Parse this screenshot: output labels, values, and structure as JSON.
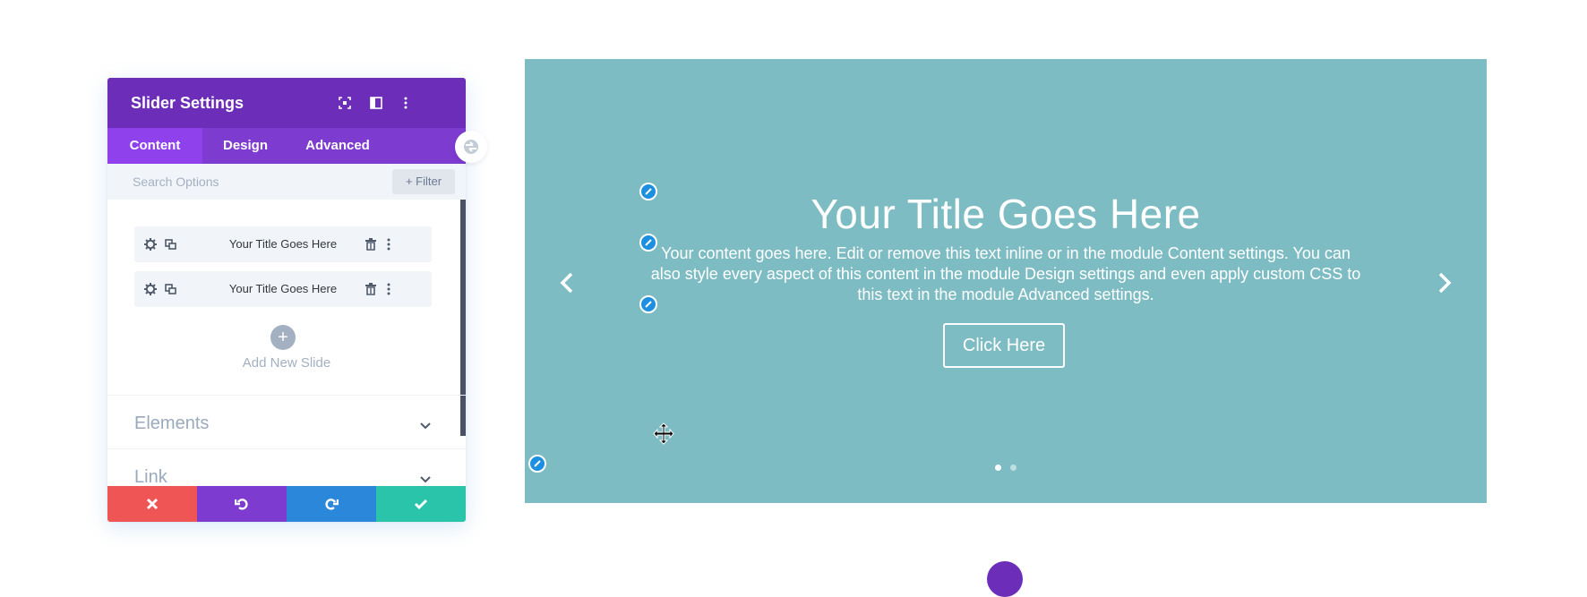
{
  "panel": {
    "title": "Slider Settings",
    "header_icons": [
      "expand-icon",
      "sidebar-layout-icon",
      "more-vertical-icon"
    ],
    "tabs": [
      {
        "label": "Content",
        "active": true
      },
      {
        "label": "Design",
        "active": false
      },
      {
        "label": "Advanced",
        "active": false
      }
    ],
    "search": {
      "placeholder": "Search Options",
      "value": ""
    },
    "filter_label": "+ Filter",
    "slides": [
      {
        "label": "Your Title Goes Here"
      },
      {
        "label": "Your Title Goes Here"
      }
    ],
    "add_slide_label": "Add New Slide",
    "sections": [
      {
        "label": "Elements"
      },
      {
        "label": "Link"
      }
    ],
    "footer": {
      "buttons": [
        {
          "name": "discard",
          "color": "#ef5555"
        },
        {
          "name": "undo",
          "color": "#7e3bd0"
        },
        {
          "name": "redo",
          "color": "#2b87da"
        },
        {
          "name": "save",
          "color": "#29c4a9"
        }
      ]
    },
    "colors": {
      "header": "#6c2eb9",
      "tabs": "#7e3bd0",
      "active_tab": "#8f42ec"
    }
  },
  "slider": {
    "background": "#7ebcc3",
    "title": "Your Title Goes Here",
    "body": "Your content goes here. Edit or remove this text inline or in the module Content settings. You can also style every aspect of this content in the module Design settings and even apply custom CSS to this text in the module Advanced settings.",
    "button_label": "Click Here",
    "dots": {
      "count": 2,
      "active": 1
    },
    "edit_pin_color": "#1d8fe1"
  }
}
